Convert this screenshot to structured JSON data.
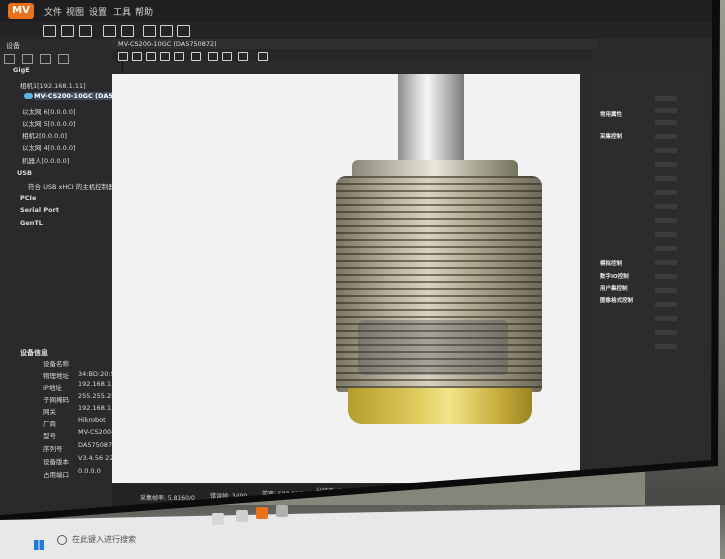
{
  "app": {
    "logo_text": "MV"
  },
  "menu": [
    "文件",
    "视图",
    "设置",
    "工具",
    "帮助"
  ],
  "left_panel": {
    "title": "设备",
    "tree": [
      {
        "label": "GigE",
        "level": 0
      },
      {
        "label": "相机1[192.168.1.11]",
        "level": 1
      },
      {
        "label": "MV-CS200-10GC (DA5750...",
        "level": 2,
        "selected": true
      },
      {
        "label": "以太网 6[0.0.0.0]",
        "level": 1
      },
      {
        "label": "以太网 5[0.0.0.0]",
        "level": 1
      },
      {
        "label": "相机2[0.0.0.0]",
        "level": 1
      },
      {
        "label": "以太网 4[0.0.0.0]",
        "level": 1
      },
      {
        "label": "机器人[0.0.0.0]",
        "level": 1
      },
      {
        "label": "USB",
        "level": 0
      },
      {
        "label": "符合 USB xHCI 的主机控制器",
        "level": 1
      },
      {
        "label": "PCIe",
        "level": 0
      },
      {
        "label": "Serial Port",
        "level": 0
      },
      {
        "label": "GenTL",
        "level": 0
      }
    ]
  },
  "device_info": {
    "header": "设备信息",
    "rows": [
      {
        "key": "设备名称",
        "value": ""
      },
      {
        "key": "物理地址",
        "value": "34:BD:20:5C:CF:16"
      },
      {
        "key": "IP地址",
        "value": "192.168.1.12"
      },
      {
        "key": "子网掩码",
        "value": "255.255.255.0"
      },
      {
        "key": "网关",
        "value": "192.168.1.254"
      },
      {
        "key": "厂商",
        "value": "Hikrobot"
      },
      {
        "key": "型号",
        "value": "MV-CS200-10GC"
      },
      {
        "key": "序列号",
        "value": "DA5750872"
      },
      {
        "key": "设备版本",
        "value": "V3.4.56 220825 875..."
      },
      {
        "key": "占用端口",
        "value": "0.0.0.0"
      }
    ]
  },
  "view": {
    "tab_title": "MV-CS200-10GC (DA5750872)"
  },
  "status": {
    "items": [
      "采集帧率: 5.8160/0",
      "错误帧: 3400",
      "带宽: 508.1Mbps",
      "分辨率: 5472 × 3648",
      "丢包: 0",
      "像素格式: BGR",
      "帧计数: 488/99"
    ]
  },
  "right_panel": {
    "categories": [
      "常用属性",
      "采集控制",
      "模拟控制",
      "数字IO控制",
      "用户集控制",
      "图像格式控制"
    ]
  },
  "taskbar": {
    "search_placeholder": "在此键入进行搜索"
  },
  "colors": {
    "accent": "#e8711c",
    "selection": "#3f4a5c",
    "brass": "#e2cf62"
  }
}
